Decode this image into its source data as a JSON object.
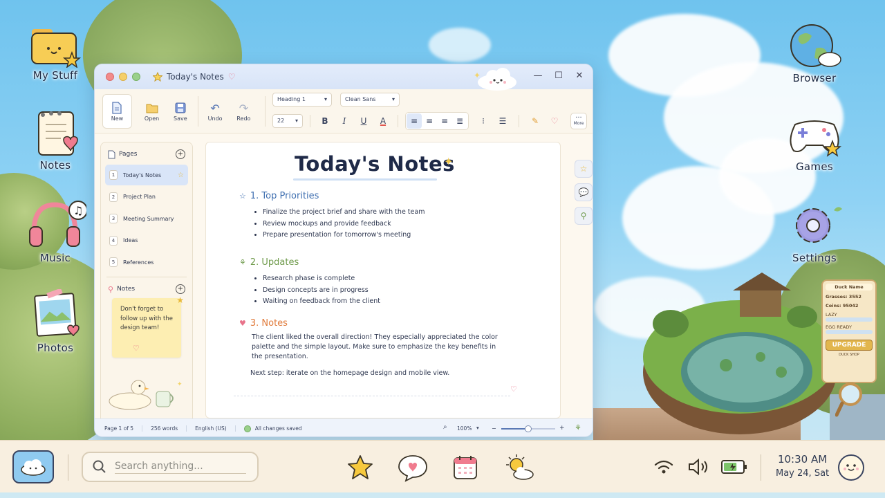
{
  "desktop": {
    "left_icons": [
      {
        "label": "My Stuff"
      },
      {
        "label": "Notes"
      },
      {
        "label": "Music"
      },
      {
        "label": "Photos"
      }
    ],
    "right_icons": [
      {
        "label": "Browser"
      },
      {
        "label": "Games"
      },
      {
        "label": "Settings"
      }
    ]
  },
  "game_widget": {
    "name_label": "Duck Name",
    "grasses": "Grasses: 3552",
    "coins": "Coins: 95042",
    "bar1_label": "LAZY",
    "bar2_label": "EGG READY",
    "upgrade": "UPGRADE",
    "shop": "DUCK SHOP"
  },
  "window": {
    "title": "Today's Notes",
    "toolbar": {
      "new": "New",
      "open": "Open",
      "save": "Save",
      "undo": "Undo",
      "redo": "Redo",
      "style_select": "Heading 1",
      "font_select": "Clean Sans",
      "size_select": "22",
      "bold": "B",
      "italic": "I",
      "underline": "U",
      "color": "A",
      "more": "More"
    },
    "sidebar": {
      "pages_title": "Pages",
      "pages": [
        {
          "num": "1",
          "label": "Today's Notes"
        },
        {
          "num": "2",
          "label": "Project Plan"
        },
        {
          "num": "3",
          "label": "Meeting Summary"
        },
        {
          "num": "4",
          "label": "Ideas"
        },
        {
          "num": "5",
          "label": "References"
        }
      ],
      "notes_title": "Notes",
      "sticky_text": "Don't forget to follow up with the design team!"
    },
    "doc": {
      "title": "Today's Notes",
      "sections": [
        {
          "heading": "1. Top Priorities",
          "color": "#3f6fb0",
          "items": [
            "Finalize the project brief and share with the team",
            "Review mockups and provide feedback",
            "Prepare presentation for tomorrow's meeting"
          ]
        },
        {
          "heading": "2. Updates",
          "color": "#6e9a4a",
          "items": [
            "Research phase is complete",
            "Design concepts are in progress",
            "Waiting on feedback from the client"
          ]
        },
        {
          "heading": "3. Notes",
          "color": "#e07a3a",
          "paragraph": "The client liked the overall direction! They especially appreciated the color palette and the simple layout. Make sure to emphasize the key benefits in the presentation.",
          "next_step": "Next step: iterate on the homepage design and mobile view."
        }
      ]
    },
    "status": {
      "page": "Page 1 of 5",
      "words": "256 words",
      "language": "English (US)",
      "saved": "All changes saved",
      "zoom": "100%",
      "zoom_level": 0.5
    }
  },
  "taskbar": {
    "search_placeholder": "Search anything...",
    "time": "10:30 AM",
    "date": "May 24, Sat",
    "battery_level": 0.7
  },
  "colors": {
    "accent_blue": "#d9e5f8",
    "sticky": "#fdeeb2",
    "taskbar": "#f8efe0"
  }
}
